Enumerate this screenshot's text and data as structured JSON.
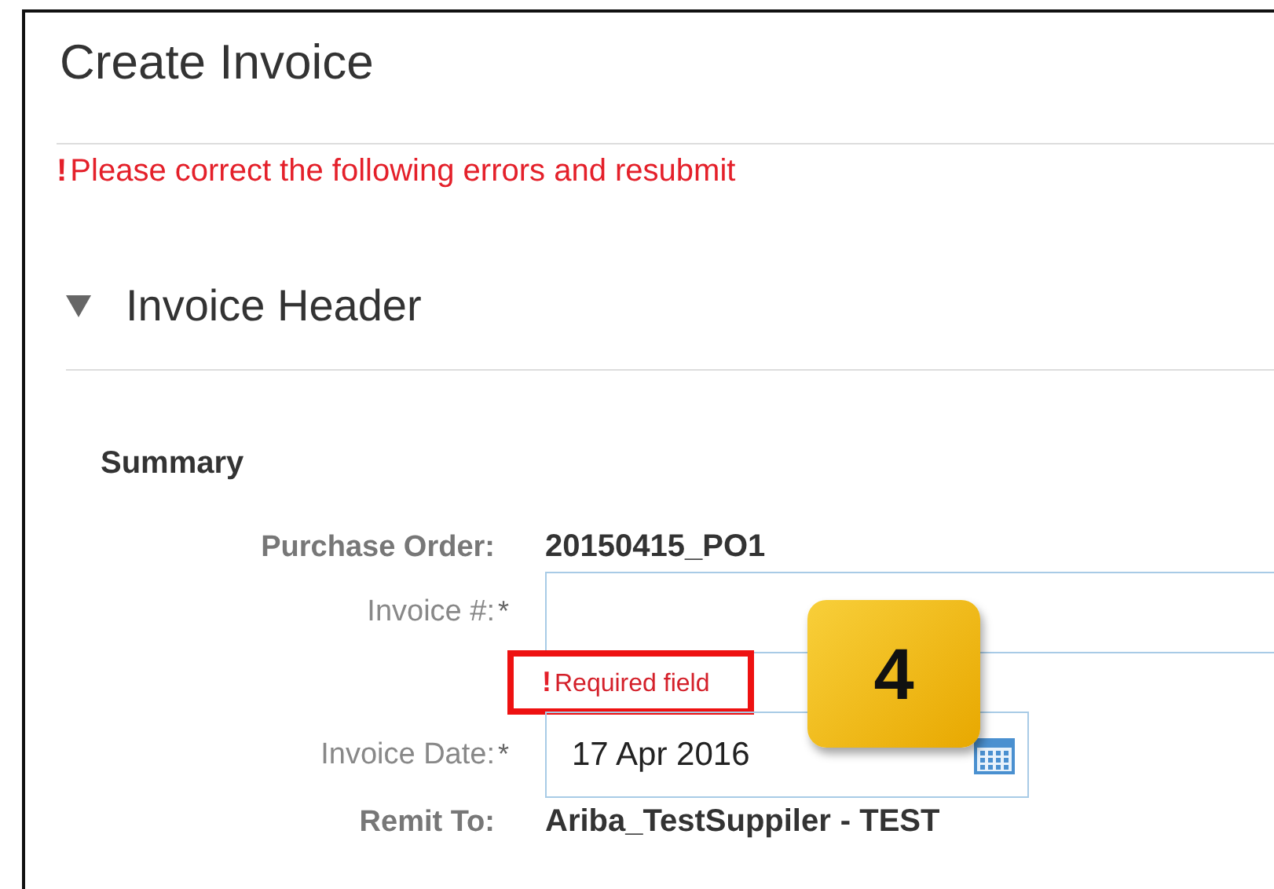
{
  "page": {
    "title": "Create Invoice"
  },
  "error_banner": {
    "icon": "!",
    "message": "Please correct the following errors and resubmit"
  },
  "section": {
    "title": "Invoice Header",
    "expanded": true
  },
  "summary": {
    "heading": "Summary",
    "fields": [
      {
        "kind": "text",
        "label": "Purchase Order:",
        "value": "20150415_PO1"
      },
      {
        "kind": "input",
        "label": "Invoice #:",
        "required_mark": "*",
        "error_icon": "!",
        "error": "Required field"
      },
      {
        "kind": "date",
        "label": "Invoice Date:",
        "required_mark": "*",
        "value": "17 Apr 2016"
      },
      {
        "kind": "text",
        "label": "Remit To:",
        "value": "Ariba_TestSuppiler",
        "suffix": "- TEST"
      }
    ]
  },
  "callout": {
    "number": "4"
  }
}
